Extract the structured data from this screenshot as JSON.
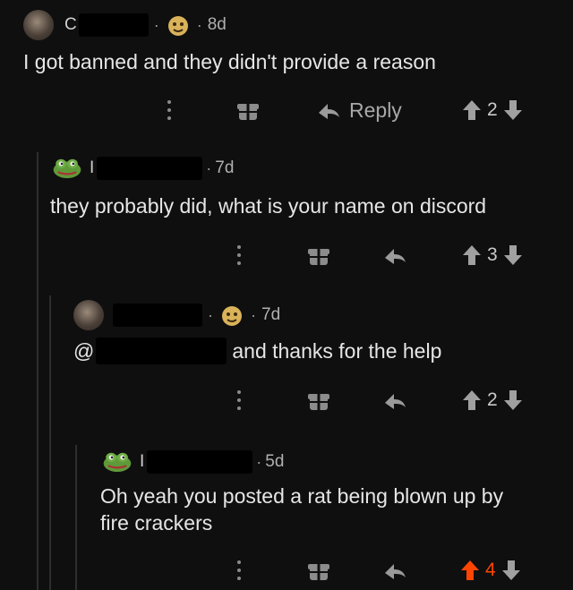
{
  "comments": [
    {
      "username": "C",
      "time": "8d",
      "text": "I got banned and they didn't provide a reason",
      "reply_label": "Reply",
      "score": "2"
    },
    {
      "username": "I",
      "time": "7d",
      "text": "they probably did, what is your name on discord",
      "score": "3"
    },
    {
      "username": "",
      "time": "7d",
      "text_prefix": "@",
      "text": "and thanks for the help",
      "score": "2"
    },
    {
      "username": "I",
      "time": "5d",
      "text_line1": "Oh yeah you posted a rat being blown up by",
      "text_line2": "fire crackers",
      "score": "4"
    }
  ],
  "icons": {
    "more": "vertical-dots-icon",
    "award": "gift-icon",
    "reply": "reply-arrow-icon",
    "upvote": "upvote-arrow-icon",
    "downvote": "downvote-arrow-icon"
  },
  "colors": {
    "background": "#0f0f10",
    "upvoted": "#ff4500",
    "text": "#e6e6e6",
    "muted": "#9a9a9a"
  }
}
